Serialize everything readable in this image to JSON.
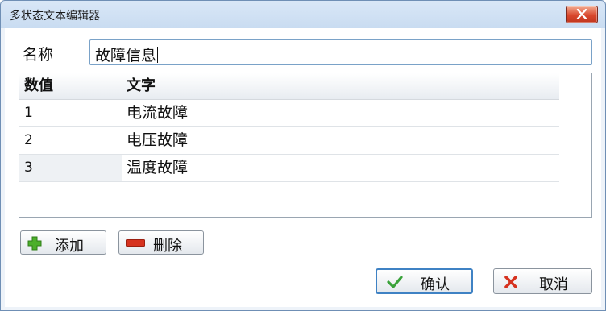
{
  "window": {
    "title": "多状态文本编辑器"
  },
  "name": {
    "label": "名称",
    "value": "故障信息"
  },
  "table": {
    "columns": [
      "数值",
      "文字"
    ],
    "rows": [
      {
        "value": "1",
        "text": "电流故障"
      },
      {
        "value": "2",
        "text": "电压故障"
      },
      {
        "value": "3",
        "text": "温度故障"
      }
    ]
  },
  "buttons": {
    "add": "添加",
    "delete": "删除",
    "ok": "确认",
    "cancel": "取消"
  },
  "icons": {
    "close": "close-icon",
    "add": "plus-icon",
    "delete": "minus-icon",
    "ok": "checkmark-icon",
    "cancel": "x-icon"
  },
  "colors": {
    "add_icon": "#4caf2a",
    "delete_icon": "#d6321f",
    "ok_icon": "#3aa23a",
    "cancel_icon": "#d6321f",
    "ok_border": "#3f82c4"
  }
}
